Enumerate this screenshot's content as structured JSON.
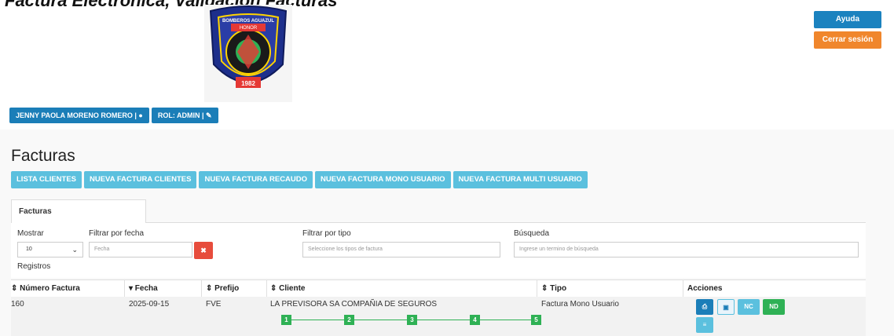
{
  "top_text": "Factura Electronica, Validacion Facturas",
  "header": {
    "logo_alt": "BOMBEROS AGUAZUL",
    "help_label": "Ayuda",
    "logout_label": "Cerrar sesión"
  },
  "user": {
    "name_label": "JENNY PAOLA MORENO ROMERO |",
    "role_label": "ROL: ADMIN |"
  },
  "page": {
    "title": "Facturas"
  },
  "actions": [
    {
      "label": "LISTA CLIENTES"
    },
    {
      "label": "NUEVA FACTURA CLIENTES"
    },
    {
      "label": "NUEVA FACTURA RECAUDO"
    },
    {
      "label": "NUEVA FACTURA MONO USUARIO"
    },
    {
      "label": "NUEVA FACTURA MULTI USUARIO"
    }
  ],
  "tab": {
    "label": "Facturas"
  },
  "filters": {
    "show_label": "Mostrar",
    "show_value": "10",
    "registros_label": "Registros",
    "date_label": "Filtrar por fecha",
    "date_placeholder": "Fecha",
    "type_label": "Filtrar por tipo",
    "type_placeholder": "Seleccione los tipos de factura",
    "search_label": "Búsqueda",
    "search_placeholder": "Ingrese un termino de búsqueda"
  },
  "table": {
    "headers": {
      "numero": "⇕ Número Factura",
      "fecha": "▾ Fecha",
      "prefijo": "⇕ Prefijo",
      "cliente": "⇕ Cliente",
      "tipo": "⇕ Tipo",
      "acciones": "Acciones"
    },
    "rows": [
      {
        "numero": "160",
        "fecha": "2025-09-15",
        "prefijo": "FVE",
        "cliente": "LA PREVISORA SA COMPAÑIA DE SEGUROS",
        "tipo": "Factura Mono Usuario",
        "steps": [
          "1",
          "2",
          "3",
          "4",
          "5"
        ],
        "actions": {
          "nc": "NC",
          "nd": "ND"
        }
      }
    ]
  },
  "colors": {
    "primary": "#1b82bf",
    "warning": "#f0862c",
    "info": "#5bc0de",
    "success": "#2fb155",
    "danger": "#e74c3c"
  }
}
